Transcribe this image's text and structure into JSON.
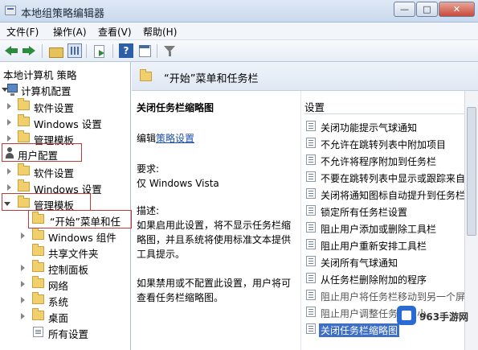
{
  "window": {
    "title": "本地组策略编辑器",
    "controls": {
      "minimize": "—",
      "maximize": "□",
      "close": "✕"
    }
  },
  "menu": [
    "文件(F)",
    "操作(A)",
    "查看(V)",
    "帮助(H)"
  ],
  "toolbar": {
    "icons": [
      "arrow-left-icon",
      "arrow-right-icon",
      "folder-up-icon",
      "grid-view-icon",
      "export-list-icon",
      "help-icon",
      "view-icon",
      "filter-icon"
    ],
    "help_glyph": "?"
  },
  "tree": {
    "root": "本地计算机 策略",
    "computer_config": "计算机配置",
    "computer_children": [
      "软件设置",
      "Windows 设置",
      "管理模板"
    ],
    "user_config": "用户配置",
    "user_children": [
      "软件设置",
      "Windows 设置",
      "管理模板"
    ],
    "admin_templates_children": [
      "“开始”菜单和任",
      "Windows 组件",
      "共享文件夹",
      "控制面板",
      "网络",
      "系统",
      "桌面",
      "所有设置"
    ]
  },
  "detail": {
    "header": "“开始”菜单和任务栏",
    "setting_title": "关闭任务栏缩略图",
    "edit_prefix": "编辑",
    "edit_link": "策略设置",
    "requirements_label": "要求:",
    "requirements_value": "仅 Windows Vista",
    "description_label": "描述:",
    "description_lines": [
      "如果启用此设置，将不显示任务栏缩",
      "略图，并且系统将使用标准文本提供",
      "工具提示。",
      "",
      "如果禁用或不配置此设置，用户将可",
      "查看任务栏缩略图。"
    ]
  },
  "list": {
    "header": "设置",
    "items": [
      "关闭功能提示气球通知",
      "不允许在跳转列表中附加项目",
      "不允许将程序附加到任务栏",
      "不要在跳转列表中显示或跟踪来自",
      "关闭将通知图标自动提升到任务栏",
      "锁定所有任务栏设置",
      "阻止用户添加或删除工具栏",
      "阻止用户重新安排工具栏",
      "关闭所有气球通知",
      "从任务栏删除附加的程序",
      "阻止用户将任务栏移动到另一个屏幕",
      "阻止用户调整任务栏大小",
      "关闭任务栏缩略图"
    ]
  },
  "watermark": {
    "text": "963手游网"
  },
  "colors": {
    "highlight_box": "#c03a3a",
    "selection": "#3d6fc4",
    "link": "#1f4fa8"
  }
}
